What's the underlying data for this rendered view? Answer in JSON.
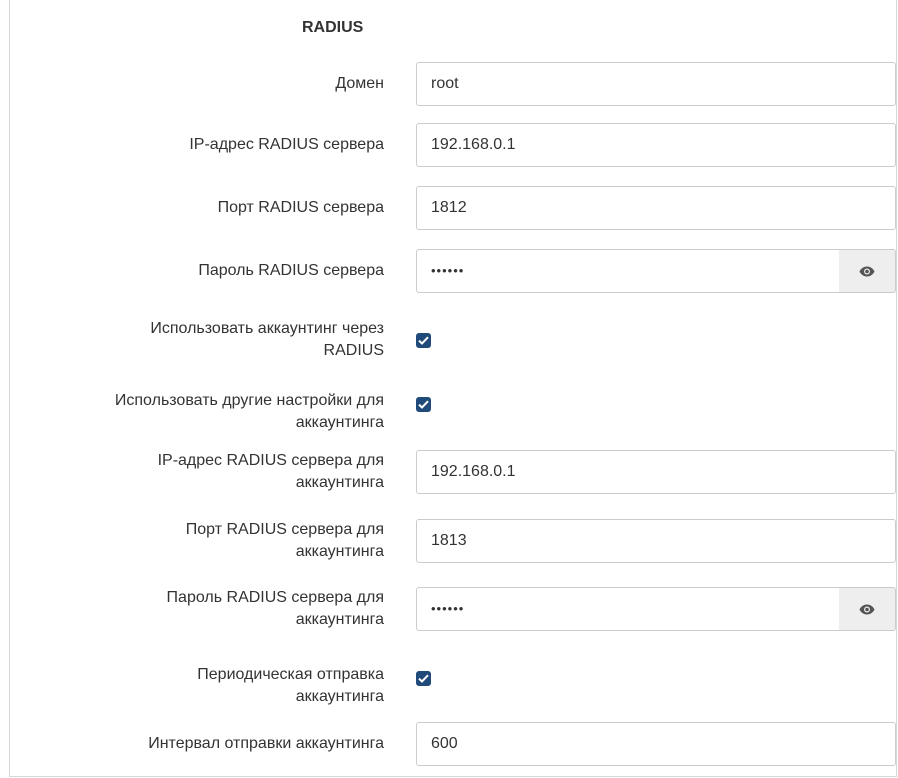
{
  "section": {
    "title": "RADIUS"
  },
  "fields": {
    "domain": {
      "label": "Домен",
      "value": "root"
    },
    "server_ip": {
      "label": "IP-адрес RADIUS сервера",
      "value": "192.168.0.1"
    },
    "server_port": {
      "label": "Порт RADIUS сервера",
      "value": "1812"
    },
    "server_password": {
      "label": "Пароль RADIUS сервера",
      "value": "••••••"
    },
    "use_accounting": {
      "label_line1": "Использовать аккаунтинг через",
      "label_line2": "RADIUS",
      "checked": true
    },
    "other_settings": {
      "label_line1": "Использовать другие настройки для",
      "label_line2": "аккаунтинга",
      "checked": true
    },
    "acct_ip": {
      "label_line1": "IP-адрес RADIUS сервера для",
      "label_line2": "аккаунтинга",
      "value": "192.168.0.1"
    },
    "acct_port": {
      "label_line1": "Порт RADIUS сервера для",
      "label_line2": "аккаунтинга",
      "value": "1813"
    },
    "acct_password": {
      "label_line1": "Пароль RADIUS сервера для",
      "label_line2": "аккаунтинга",
      "value": "••••••"
    },
    "periodic": {
      "label_line1": "Периодическая отправка",
      "label_line2": "аккаунтинга",
      "checked": true
    },
    "interval": {
      "label": "Интервал отправки аккаунтинга",
      "value": "600"
    }
  },
  "icons": {
    "eye": "eye-icon",
    "check": "checkmark-icon"
  },
  "colors": {
    "checkbox": "#1f4a7a",
    "eye_button_bg": "#eeeeee",
    "border": "#cccccc"
  }
}
